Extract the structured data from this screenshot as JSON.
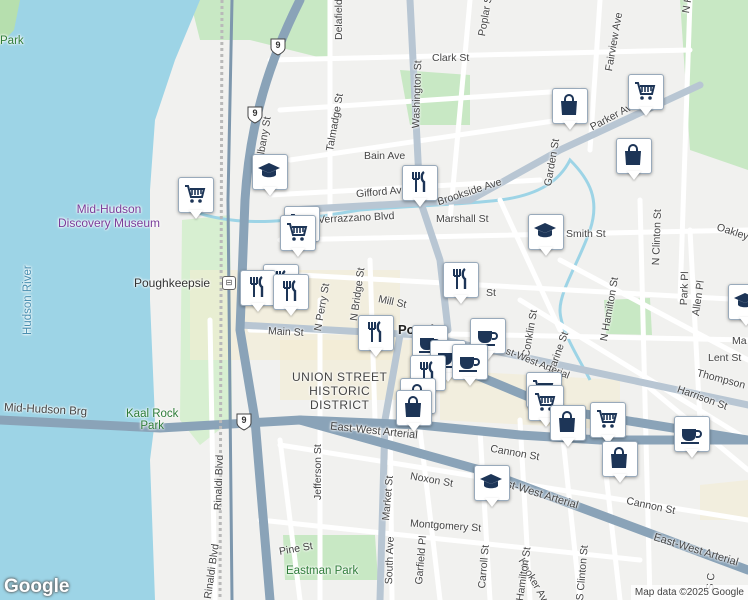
{
  "map": {
    "attribution": "Map data ©2025 Google",
    "logo": "Google",
    "colors": {
      "water": "#9dd4e6",
      "park": "#c8e8c4",
      "highway": "#8aa3b8",
      "arterial": "#b8c6d3",
      "road": "#ffffff",
      "marker_icon": "#1d3557"
    }
  },
  "labels": {
    "park_top": "Park",
    "hudson_river": "Hudson River",
    "mid_hudson_museum": "Mid-Hudson\nDiscovery Museum",
    "poughkeepsie_station": "Poughkeepsie",
    "kaal_rock_park": "Kaal Rock\nPark",
    "mid_hudson_brg": "Mid-Hudson Brg",
    "union_street": "UNION STREET\nHISTORIC\nDISTRICT",
    "eastman_park": "Eastman Park",
    "city_partial": "Pough",
    "streets": {
      "delafield": "Delafield St",
      "poplar": "Poplar St",
      "fairview": "Fairview Ave",
      "hamilton_top": "N Hamilton St",
      "clark": "Clark St",
      "washington": "Washington St",
      "talmadge": "Talmadge St",
      "albany": "Albany St",
      "bain": "Bain Ave",
      "parker": "Parker Ave",
      "gifford": "Gifford Ave",
      "brookside": "Brookside Ave",
      "verrazzano": "Verrazzano Blvd",
      "marshall": "Marshall St",
      "garden": "Garden St",
      "smith": "Smith St",
      "oakley": "Oakley St",
      "n_clinton": "N Clinton St",
      "n_hamilton": "N Hamilton St",
      "park_pl": "Park Pl",
      "allen": "Allen Pl",
      "n_perry": "N Perry St",
      "n_bridge": "N Bridge St",
      "mill": "Mill St",
      "mill_east": "St",
      "conklin": "Conklin St",
      "catharine": "Catharine St",
      "main": "Main St",
      "east_west_1": "East-West Arterial",
      "east_west_2": "East-West Arterial",
      "east_west_3": "East-West Arterial",
      "east_west_4": "East-West Arterial",
      "lent": "Lent St",
      "thompson": "Thompson St",
      "harrison": "Harrison St",
      "cannon_1": "Cannon St",
      "cannon_2": "Cannon St",
      "jefferson": "Jefferson St",
      "rinaldi_1": "Rinaldi Blvd",
      "rinaldi_2": "Rinaldi Blvd",
      "market": "Market St",
      "noxon": "Noxon St",
      "montgomery": "Montgomery St",
      "pine": "Pine St",
      "south_ave": "South Ave",
      "garfield": "Garfield Pl",
      "carroll": "Carroll St",
      "hooker": "Hooker Ave",
      "hamilton_s": "Hamilton St",
      "s_clinton": "S Clinton St",
      "s_c": "S C",
      "ma": "Ma"
    },
    "shields": {
      "route9_a": "9",
      "route9_b": "9",
      "route9_c": "9"
    }
  },
  "markers": [
    {
      "name": "grocery-marker",
      "icon": "cart"
    },
    {
      "name": "university-marker",
      "icon": "cap"
    },
    {
      "name": "restaurant-marker",
      "icon": "utensils"
    },
    {
      "name": "shopping-marker",
      "icon": "bag"
    },
    {
      "name": "cafe-marker",
      "icon": "cup"
    }
  ]
}
